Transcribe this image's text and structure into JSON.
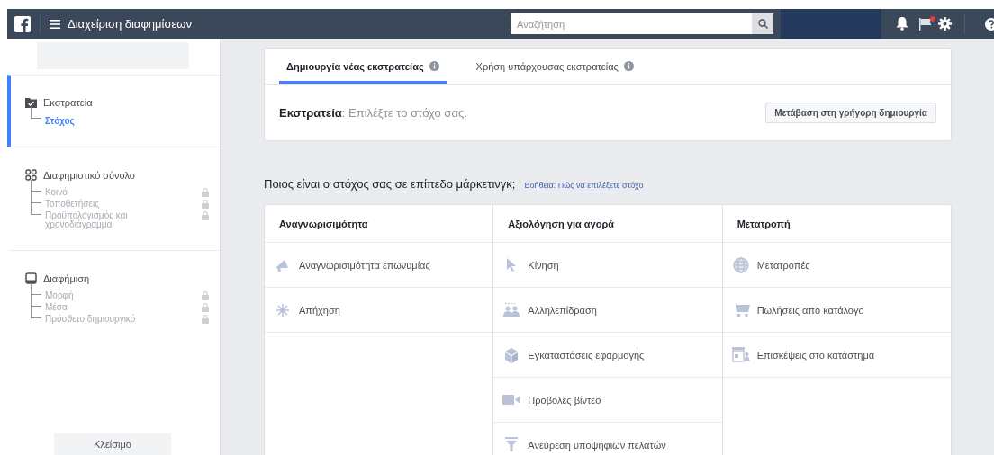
{
  "top_bar": {
    "title": "Διαχείριση διαφημίσεων",
    "search": {
      "placeholder": "Αναζήτηση"
    },
    "notification_dot": true
  },
  "sidebar": {
    "sections": [
      {
        "title": "Εκστρατεία",
        "kind": "folder",
        "active": true,
        "items": [
          {
            "label": "Στόχος",
            "selected": true,
            "locked": false
          }
        ]
      },
      {
        "title": "Διαφημιστικό σύνολο",
        "kind": "grid",
        "active": false,
        "items": [
          {
            "label": "Κοινό",
            "selected": false,
            "locked": true
          },
          {
            "label": "Τοποθετήσεις",
            "selected": false,
            "locked": true
          },
          {
            "label": "Προϋπολογισμός και χρονοδιάγραμμα",
            "selected": false,
            "locked": true
          }
        ]
      },
      {
        "title": "Διαφήμιση",
        "kind": "screen",
        "active": false,
        "items": [
          {
            "label": "Μορφή",
            "selected": false,
            "locked": true
          },
          {
            "label": "Μέσα",
            "selected": false,
            "locked": true
          },
          {
            "label": "Πρόσθετο δημιουργικό",
            "selected": false,
            "locked": true
          }
        ]
      }
    ],
    "close_button": "Κλείσιμο"
  },
  "tabs": [
    {
      "label": "Δημιουργία νέας εκστρατείας",
      "selected": true
    },
    {
      "label": "Χρήση υπάρχουσας εκστρατείας",
      "selected": false
    }
  ],
  "campaign": {
    "text": "**Εκστρατεία**: Επιλέξτε το στόχο σας.",
    "quick_button": "Μετάβαση στη γρήγορη δημιουργία"
  },
  "question": "Ποιος είναι ο στόχος σας σε επίπεδο μάρκετινγκ;",
  "help_link": "Βοήθεια: Πώς να επιλέξετε στόχο",
  "objectives": [
    {
      "heading": "Αναγνωρισιμότητα",
      "items": [
        {
          "label": "Αναγνωρισιμότητα επωνυμίας",
          "kind": "megaphone"
        },
        {
          "label": "Απήχηση",
          "kind": "network"
        }
      ]
    },
    {
      "heading": "Αξιολόγηση για αγορά",
      "items": [
        {
          "label": "Κίνηση",
          "kind": "cursor"
        },
        {
          "label": "Αλληλεπίδραση",
          "kind": "people"
        },
        {
          "label": "Εγκαταστάσεις εφαρμογής",
          "kind": "cube"
        },
        {
          "label": "Προβολές βίντεο",
          "kind": "camera"
        },
        {
          "label": "Ανεύρεση υποψήφιων πελατών",
          "kind": "funnel"
        }
      ]
    },
    {
      "heading": "Μετατροπή",
      "items": [
        {
          "label": "Μετατροπές",
          "kind": "globe"
        },
        {
          "label": "Πωλήσεις από κατάλογο",
          "kind": "cart"
        },
        {
          "label": "Επισκέψεις στο κατάστημα",
          "kind": "store"
        }
      ]
    }
  ]
}
